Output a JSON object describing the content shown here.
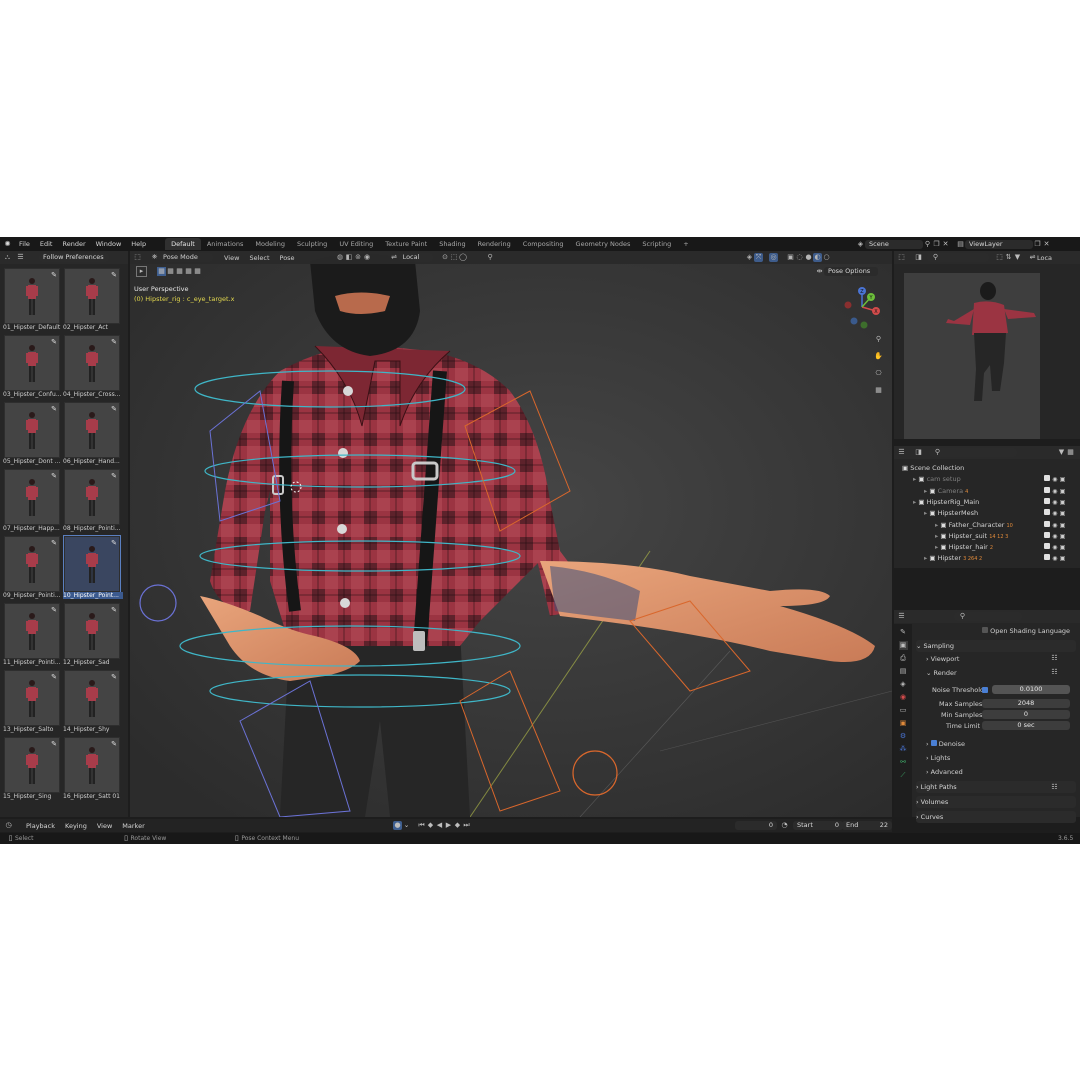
{
  "topbar": {
    "menu": [
      "File",
      "Edit",
      "Render",
      "Window",
      "Help"
    ],
    "workspaces": [
      "Default",
      "Animations",
      "Modeling",
      "Sculpting",
      "UV Editing",
      "Texture Paint",
      "Shading",
      "Rendering",
      "Compositing",
      "Geometry Nodes",
      "Scripting"
    ],
    "add_tab": "+",
    "scene": "Scene",
    "view_layer": "ViewLayer"
  },
  "asset_browser": {
    "dropdown": "Follow Preferences",
    "items": [
      "01_Hipster_Default",
      "02_Hipster_Act",
      "03_Hipster_Confu...",
      "04_Hipster_Cross...",
      "05_Hipster_Dont ...",
      "06_Hipster_Hand...",
      "07_Hipster_Happ...",
      "08_Hipster_Pointi...",
      "09_Hipster_Pointi...",
      "10_Hipster_Point...",
      "11_Hipster_Pointi...",
      "12_Hipster_Sad",
      "13_Hipster_Salto",
      "14_Hipster_Shy",
      "15_Hipster_Sing",
      "16_Hipster_Satt 01"
    ],
    "selected_index": 9
  },
  "viewport": {
    "mode": "Pose Mode",
    "menus": [
      "View",
      "Select",
      "Pose"
    ],
    "transform_orientation": "Local",
    "pose_options": "Pose Options",
    "overlay_title": "User Perspective",
    "overlay_subtitle": "(0) Hipster_rig : c_eye_target.x",
    "gizmo_axes": [
      "X",
      "Y",
      "Z"
    ]
  },
  "camera_preview_header": {
    "local": "Loca"
  },
  "outliner": {
    "rows": [
      {
        "label": "Scene Collection",
        "indent": 0
      },
      {
        "label": "cam setup",
        "indent": 1,
        "dim": true
      },
      {
        "label": "Camera",
        "indent": 2,
        "dim": true,
        "badge": "4"
      },
      {
        "label": "HipsterRig_Main",
        "indent": 1
      },
      {
        "label": "HipsterMesh",
        "indent": 2
      },
      {
        "label": "Father_Character",
        "indent": 3,
        "badge": "10"
      },
      {
        "label": "Hipster_suit",
        "indent": 3,
        "badge": "14 12 3"
      },
      {
        "label": "Hipster_hair",
        "indent": 3,
        "badge": "2"
      },
      {
        "label": "Hipster",
        "indent": 2,
        "badge": "3 264 2"
      }
    ]
  },
  "properties": {
    "open_shading_language": "Open Shading Language",
    "sampling": "Sampling",
    "viewport": "Viewport",
    "render": "Render",
    "noise_threshold_label": "Noise Threshold",
    "noise_threshold": "0.0100",
    "max_samples_label": "Max Samples",
    "max_samples": "2048",
    "min_samples_label": "Min Samples",
    "min_samples": "0",
    "time_limit_label": "Time Limit",
    "time_limit": "0 sec",
    "denoise": "Denoise",
    "lights": "Lights",
    "advanced": "Advanced",
    "light_paths": "Light Paths",
    "volumes": "Volumes",
    "curves": "Curves"
  },
  "timeline": {
    "menus": [
      "Playback",
      "Keying",
      "View",
      "Marker"
    ],
    "current_frame": "0",
    "start_label": "Start",
    "start": "0",
    "end_label": "End",
    "end": "22"
  },
  "statusbar": {
    "select": "Select",
    "rotate_view": "Rotate View",
    "context_menu": "Pose Context Menu",
    "version": "3.6.5"
  },
  "colors": {
    "accent": "#4a7fd4",
    "shirt": "#8c2f3a",
    "viewport_bg": "#3b3b3b"
  }
}
